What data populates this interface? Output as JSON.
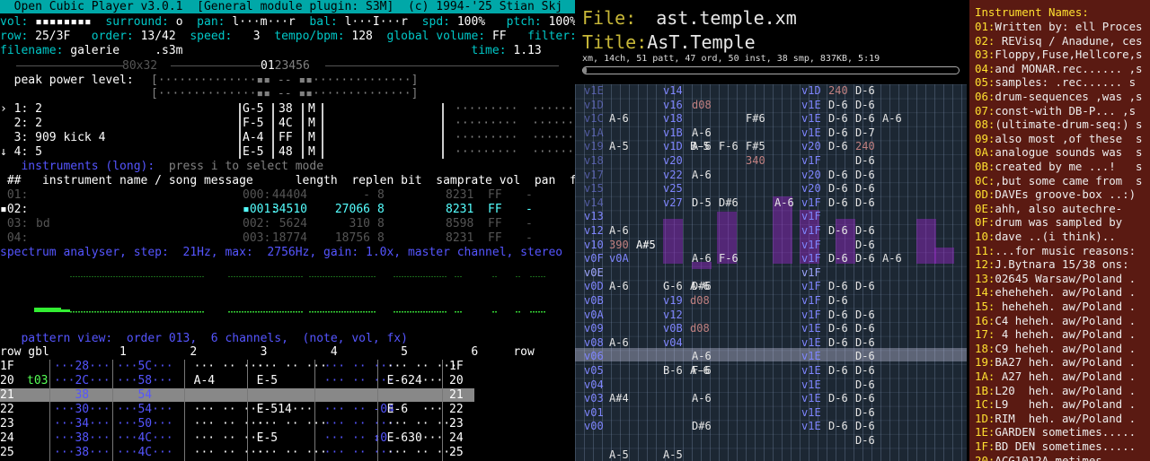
{
  "ocp": {
    "title": "  Open Cubic Player v3.0.1  [General module plugin: S3M]  (c) 1994-'25 Stian Skj",
    "status": [
      [
        [
          "vol: ",
          "cy"
        ],
        [
          "▪▪▪▪▪▪▪▪",
          "wh"
        ],
        [
          "  surround: ",
          "cy"
        ],
        [
          "o",
          "wh"
        ],
        [
          "  pan: ",
          "cy"
        ],
        [
          "l···m···r",
          "wh"
        ],
        [
          "  bal: ",
          "cy"
        ],
        [
          "l···I···r",
          "wh"
        ],
        [
          "  spd: ",
          "cy"
        ],
        [
          "100%",
          "wh"
        ],
        [
          "   ptch: ",
          "cy"
        ],
        [
          "100%",
          "wh"
        ]
      ],
      [
        [
          "row: ",
          "cy"
        ],
        [
          "25/3F",
          "wh"
        ],
        [
          "   order: ",
          "cy"
        ],
        [
          "13/42",
          "wh"
        ],
        [
          "  speed: ",
          "cy"
        ],
        [
          "  3",
          "wh"
        ],
        [
          "  tempo/bpm: ",
          "cy"
        ],
        [
          "128",
          "wh"
        ],
        [
          "  global volume: ",
          "cy"
        ],
        [
          "FF",
          "wh"
        ],
        [
          "   filter: ",
          "cy"
        ],
        [
          "FOI",
          "wh"
        ]
      ],
      [
        [
          "filename: ",
          "cy"
        ],
        [
          "galerie     .s3m",
          "wh"
        ],
        [
          "                                         time: ",
          "cy"
        ],
        [
          "1.13",
          "wh"
        ]
      ]
    ],
    "scope_label": "80x32",
    "scope_label2": "01",
    "scope_label3": "23456",
    "peak_label": "  peak power level:",
    "peak_l": "[··············▪▪ -- ▪▪··············]",
    "peak_r": "[··············▪▪ -- ▪▪··············]",
    "channels": [
      {
        "mark": "›",
        "num": "1:",
        "text": "2",
        "note": "G-5",
        "ins": "38",
        "fx": "M"
      },
      {
        "mark": " ",
        "num": "2:",
        "text": "2",
        "note": "F-5",
        "ins": "4C",
        "fx": "M"
      },
      {
        "mark": " ",
        "num": "3:",
        "text": "909 kick 4",
        "note": "A-4",
        "ins": "FF",
        "fx": "M"
      },
      {
        "mark": "↓",
        "num": "4:",
        "text": "5",
        "note": "E-5",
        "ins": "48",
        "fx": "M"
      }
    ],
    "dots": "·········  ·······",
    "instruments_hdr": "   instruments (long):",
    "instruments_hint": "  press i to select mode",
    "inst_cols": " ##   instrument name / song message      length  replen bit  samprate vol  pan  flgs",
    "inst_rows": [
      {
        "cls": "dg",
        "num": " 01:",
        "name": "",
        "idx": "000:",
        "len": "44404",
        "rep": "-",
        "bit": "8",
        "rate": "8231",
        "vol": "FF",
        "pan": "-"
      },
      {
        "cls": "hl",
        "num": "▪02:",
        "name": "",
        "idx": "▪001:",
        "len": "34510",
        "rep": "27066",
        "bit": "8",
        "rate": "8231",
        "vol": "FF",
        "pan": "-"
      },
      {
        "cls": "dg",
        "num": " 03:",
        "name": "bd",
        "idx": "002:",
        "len": "5624",
        "rep": "310",
        "bit": "8",
        "rate": "8598",
        "vol": "FF",
        "pan": "-"
      },
      {
        "cls": "dg",
        "num": " 04:",
        "name": "",
        "idx": "003:",
        "len": "18774",
        "rep": "18756",
        "bit": "8",
        "rate": "8231",
        "vol": "FF",
        "pan": "-"
      }
    ],
    "spectrum_hdr": "spectrum analyser, step:  21Hz, max:  2756Hz, gain: 1.0x, master channel, stereo",
    "pattern_hdr": "   pattern view:  order 013,  6 channels,  (note, vol, fx)",
    "pattern_cols": "row gbl          1         2         3         4         5         6     row",
    "pattern_rows": [
      {
        "row": "1F",
        "g": "   ",
        "c1": "···28···",
        "c2": "···5C···",
        "c3": "  ··· ·· ···",
        "c4": "  ··· ·· ···",
        "c5": "  ··· ·· ···",
        "c6": "  ··· ·· ···",
        "r": "1F"
      },
      {
        "row": "20",
        "g": "t03",
        "c1": "···2C···",
        "c2": "···58···",
        "c3": "  A-4      ",
        "c4": "  E-5      ",
        "c5": "  ··· ·· ···",
        "c6": "  E-624···",
        "r": "20"
      },
      {
        "row": "21",
        "g": "   ",
        "c1": "   38   ",
        "c2": "   54   ",
        "c3": "            ",
        "c4": "            ",
        "c5": "            ",
        "c6": "            ",
        "r": "21"
      },
      {
        "row": "22",
        "g": "   ",
        "c1": "···30···",
        "c2": "···54···",
        "c3": "  ··· ·· ···",
        "c4": "  E-514···",
        "c5": "  ··· ·· -04",
        "c6": "  E-6  ···",
        "r": "22"
      },
      {
        "row": "23",
        "g": "   ",
        "c1": "···34···",
        "c2": "···50···",
        "c3": "  ··· ·· ···",
        "c4": "  ··· ·· ···",
        "c5": "  ··· ·· ···",
        "c6": "  ··· ·· ···",
        "r": "23"
      },
      {
        "row": "24",
        "g": "   ",
        "c1": "···38···",
        "c2": "···4C···",
        "c3": "  ··· ·· ···",
        "c4": "  E-5      ",
        "c5": "  ··· ·· ↕0",
        "c6": "  E-630···",
        "r": "24"
      },
      {
        "row": "25",
        "g": "   ",
        "c1": "···38···",
        "c2": "···4C···",
        "c3": "  ··· ·· ···",
        "c4": "  ··· ·· ···",
        "c5": "  ··· ·· ···",
        "c6": "  ··· ·· ···",
        "r": "25"
      }
    ]
  },
  "module": {
    "file_label": "File:",
    "file_value": "ast.temple.xm",
    "title_label": "Title:",
    "title_value": "AsT.Temple",
    "info": "xm, 14ch, 51 patt, 47 ord, 50 inst, 38 smp, 837KB, 5:19",
    "progress": 0.01,
    "rows": [
      [
        "v1E",
        "",
        "",
        "v14",
        "",
        "",
        "",
        "",
        "",
        "v1D",
        "240",
        "D-6",
        ""
      ],
      [
        "v1D",
        "",
        "",
        "v16",
        "",
        "d08",
        "",
        "",
        "",
        "v1E",
        "D-6",
        "D-6",
        ""
      ],
      [
        "v1C",
        "A-6",
        "",
        "v18",
        "",
        "",
        "",
        "F#6",
        "",
        "v1E",
        "D-6",
        "D-6",
        "A-6"
      ],
      [
        "v1A",
        "",
        "",
        "v1B",
        "",
        "A-6",
        "",
        "",
        "",
        "v1E",
        "D-6",
        "D-7",
        ""
      ],
      [
        "v19",
        "A-5",
        "",
        "v1D",
        "B-5",
        "A-6",
        "F-6",
        "F#5",
        "",
        "v20",
        "D-6",
        "240",
        ""
      ],
      [
        "v18",
        "",
        "",
        "v20",
        "",
        "",
        "",
        "340",
        "",
        "v1F",
        "",
        "D-6",
        ""
      ],
      [
        "v17",
        "",
        "",
        "v22",
        "",
        "A-6",
        "",
        "",
        "",
        "v20",
        "D-6",
        "D-6",
        ""
      ],
      [
        "v15",
        "",
        "",
        "v25",
        "",
        "",
        "",
        "",
        "",
        "v20",
        "D-6",
        "D-6",
        ""
      ],
      [
        "v14",
        "",
        "",
        "v27",
        "",
        "D-5",
        "D#6",
        "",
        "A-6",
        "v1F",
        "D-6",
        "D-6",
        ""
      ],
      [
        "v13",
        "",
        "",
        "",
        "",
        "",
        "",
        "",
        "",
        "v1F",
        "",
        "",
        ""
      ],
      [
        "v12",
        "A-6",
        "",
        "",
        "",
        "",
        "",
        "",
        "",
        "v1F",
        "D-6",
        "D-6",
        ""
      ],
      [
        "v10",
        "390",
        "A#5",
        "",
        "",
        "",
        "",
        "",
        "",
        "v1F",
        "",
        "D-6",
        ""
      ],
      [
        "v0F",
        "v0A",
        "",
        "",
        "",
        "A-6",
        "F-6",
        "",
        "",
        "v1F",
        "D-6",
        "D-6",
        "A-6"
      ],
      [
        "v0E",
        "",
        "",
        "",
        "",
        "",
        "",
        "",
        "",
        "v1F",
        "",
        "",
        ""
      ],
      [
        "v0D",
        "A-6",
        "",
        "G-6",
        "A-6",
        "D#6",
        "",
        "",
        "",
        "v1F",
        "D-6",
        "D-6",
        ""
      ],
      [
        "v0B",
        "",
        "",
        "v19",
        "d08",
        "",
        "",
        "",
        "",
        "v1F",
        "D-6",
        "",
        ""
      ],
      [
        "v0A",
        "",
        "",
        "v12",
        "",
        "",
        "",
        "",
        "",
        "v1F",
        "D-6",
        "D-6",
        ""
      ],
      [
        "v09",
        "",
        "",
        "v0B",
        "d08",
        "",
        "",
        "",
        "",
        "v1E",
        "D-6",
        "D-6",
        ""
      ],
      [
        "v08",
        "A-6",
        "",
        "v04",
        "",
        "",
        "",
        "",
        "",
        "v1E",
        "D-6",
        "D-6",
        ""
      ],
      [
        "v06",
        "",
        "",
        "",
        "",
        "A-6",
        "",
        "",
        "",
        "v1E",
        "",
        "D-6",
        ""
      ],
      [
        "v05",
        "",
        "",
        "B-6",
        "A-6",
        "F-6",
        "",
        "",
        "",
        "v1E",
        "D-6",
        "D-6",
        ""
      ],
      [
        "v04",
        "",
        "",
        "",
        "",
        "",
        "",
        "",
        "",
        "v1E",
        "",
        "D-6",
        ""
      ],
      [
        "v03",
        "A#4",
        "",
        "",
        "",
        "A-6",
        "",
        "",
        "",
        "v1E",
        "D-6",
        "D-6",
        ""
      ],
      [
        "v01",
        "",
        "",
        "",
        "",
        "",
        "",
        "",
        "",
        "v1E",
        "",
        "D-6",
        ""
      ],
      [
        "v00",
        "",
        "",
        "",
        "",
        "D#6",
        "",
        "",
        "",
        "v1E",
        "D-6",
        "D-6",
        ""
      ],
      [
        "",
        "",
        "",
        "",
        "",
        "",
        "",
        "",
        "",
        "",
        "",
        "D-6",
        ""
      ],
      [
        "",
        "A-5",
        "",
        "A-5",
        "",
        "",
        "",
        "",
        "",
        "",
        "",
        "",
        ""
      ]
    ]
  },
  "instrument_list": {
    "title": "Instrument Names:",
    "items": [
      [
        "01:",
        "Written by: ell Proces"
      ],
      [
        "02:",
        " REVisq / Anadune, ces"
      ],
      [
        "03:",
        "Floppy,Fuse,Hellcore,s"
      ],
      [
        "04:",
        "and MONAR.rec...... ,s"
      ],
      [
        "05:",
        "samples: .rec...... s"
      ],
      [
        "06:",
        "drum-sequences ,was ,s"
      ],
      [
        "07:",
        "const-with DB-P... ,s"
      ],
      [
        "08:",
        "(ultimate-drum-seq:) s"
      ],
      [
        "09:",
        "also most ,of these  s"
      ],
      [
        "0A:",
        "analogue sounds was  s"
      ],
      [
        "0B:",
        "created by me ...!   s"
      ],
      [
        "0C:",
        ",but some came from  s"
      ],
      [
        "0D:",
        "DAVEs groove-box ..:)"
      ],
      [
        "0E:",
        "ahh, also autechre-"
      ],
      [
        "0F:",
        "drum was sampled by"
      ],
      [
        "10:",
        "dave ..(i think).."
      ],
      [
        "11:",
        "...for music reasons:"
      ],
      [
        "12:",
        "J.Bytnara 15/38 ons:"
      ],
      [
        "13:",
        "02645 Warsaw/Poland ."
      ],
      [
        "14:",
        "eheheheh. aw/Poland ."
      ],
      [
        "15:",
        " heheheh. aw/Poland ."
      ],
      [
        "16:",
        "C4 heheh. aw/Poland ."
      ],
      [
        "17:",
        " 4 heheh. aw/Poland ."
      ],
      [
        "18:",
        "C9 heheh. aw/Poland ."
      ],
      [
        "19:",
        "BA27 heh. aw/Poland ."
      ],
      [
        "1A:",
        " A27 heh. aw/Poland ."
      ],
      [
        "1B:",
        "L20  heh. aw/Poland ."
      ],
      [
        "1C:",
        "L9   heh. aw/Poland ."
      ],
      [
        "1D:",
        "RIM  heh. aw/Poland ."
      ],
      [
        "1E:",
        "GARDEN sometimes....."
      ],
      [
        "1F:",
        "BD DEN sometimes....."
      ],
      [
        "20:",
        "ACG1012A metimes....."
      ]
    ]
  }
}
